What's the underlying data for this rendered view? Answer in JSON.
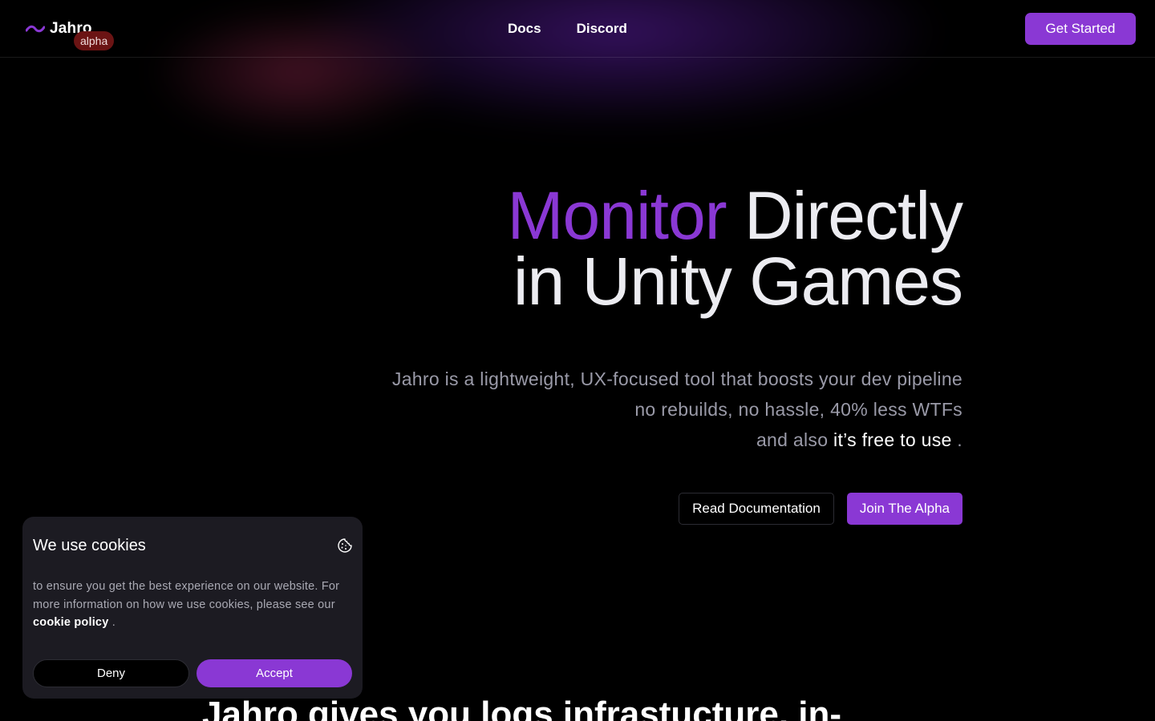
{
  "header": {
    "logo_text": "Jahro",
    "badge": "alpha",
    "nav": [
      {
        "label": "Docs"
      },
      {
        "label": "Discord"
      }
    ],
    "cta_label": "Get Started"
  },
  "hero": {
    "title_accent": "Monitor",
    "title_rest": "Directly",
    "title_line2": "in Unity Games",
    "subtitle_line1": "Jahro is a lightweight, UX-focused tool that boosts your dev pipeline",
    "subtitle_line2": "no rebuilds, no hassle, 40% less WTFs",
    "subtitle_line3_prefix": "and also",
    "subtitle_line3_highlight": "it’s free to use",
    "subtitle_line3_suffix": ".",
    "read_docs_label": "Read Documentation",
    "join_label": "Join The Alpha"
  },
  "section": {
    "title": "Jahro gives you logs infrastucture, in-"
  },
  "cookie": {
    "title": "We use cookies",
    "text_before": "to ensure you get the best experience on our website. For more information on how we use cookies, please see our",
    "link": "cookie policy",
    "text_after": ".",
    "deny_label": "Deny",
    "accept_label": "Accept"
  },
  "colors": {
    "accent": "#8a38d4",
    "badge_bg": "#6b1414",
    "background": "#000000",
    "card": "#1c1b22"
  },
  "icons": {
    "logo": "wave-icon",
    "cookie": "cookie-icon"
  }
}
